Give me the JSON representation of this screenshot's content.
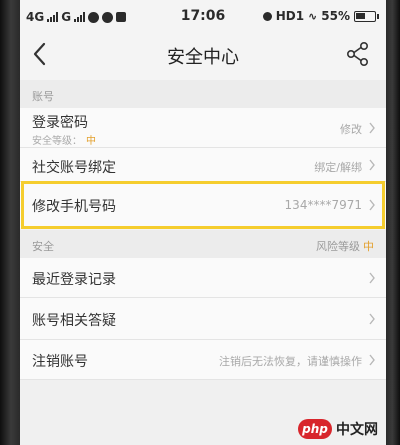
{
  "status_bar": {
    "network_left": "4G",
    "network_right": "G",
    "time": "17:06",
    "hd_label": "HD1",
    "battery": "55%",
    "battery_level": 0.55
  },
  "nav": {
    "title": "安全中心"
  },
  "sections": [
    {
      "label": "账号",
      "rows": [
        {
          "title": "登录密码",
          "subtitle": "安全等级：",
          "level": "中",
          "value": "修改"
        },
        {
          "title": "社交账号绑定",
          "value": "绑定/解绑"
        },
        {
          "title": "修改手机号码",
          "value": "134****7971"
        }
      ]
    },
    {
      "label": "安全",
      "right_label": "风险等级",
      "right_level": "中",
      "rows": [
        {
          "title": "最近登录记录",
          "value": ""
        },
        {
          "title": "账号相关答疑",
          "value": ""
        },
        {
          "title": "注销账号",
          "value": "注销后无法恢复，请谨慎操作"
        }
      ]
    }
  ],
  "watermark": {
    "logo": "php",
    "text": "中文网"
  },
  "colors": {
    "highlight": "#f5cd2e",
    "level": "#e3a02d"
  }
}
